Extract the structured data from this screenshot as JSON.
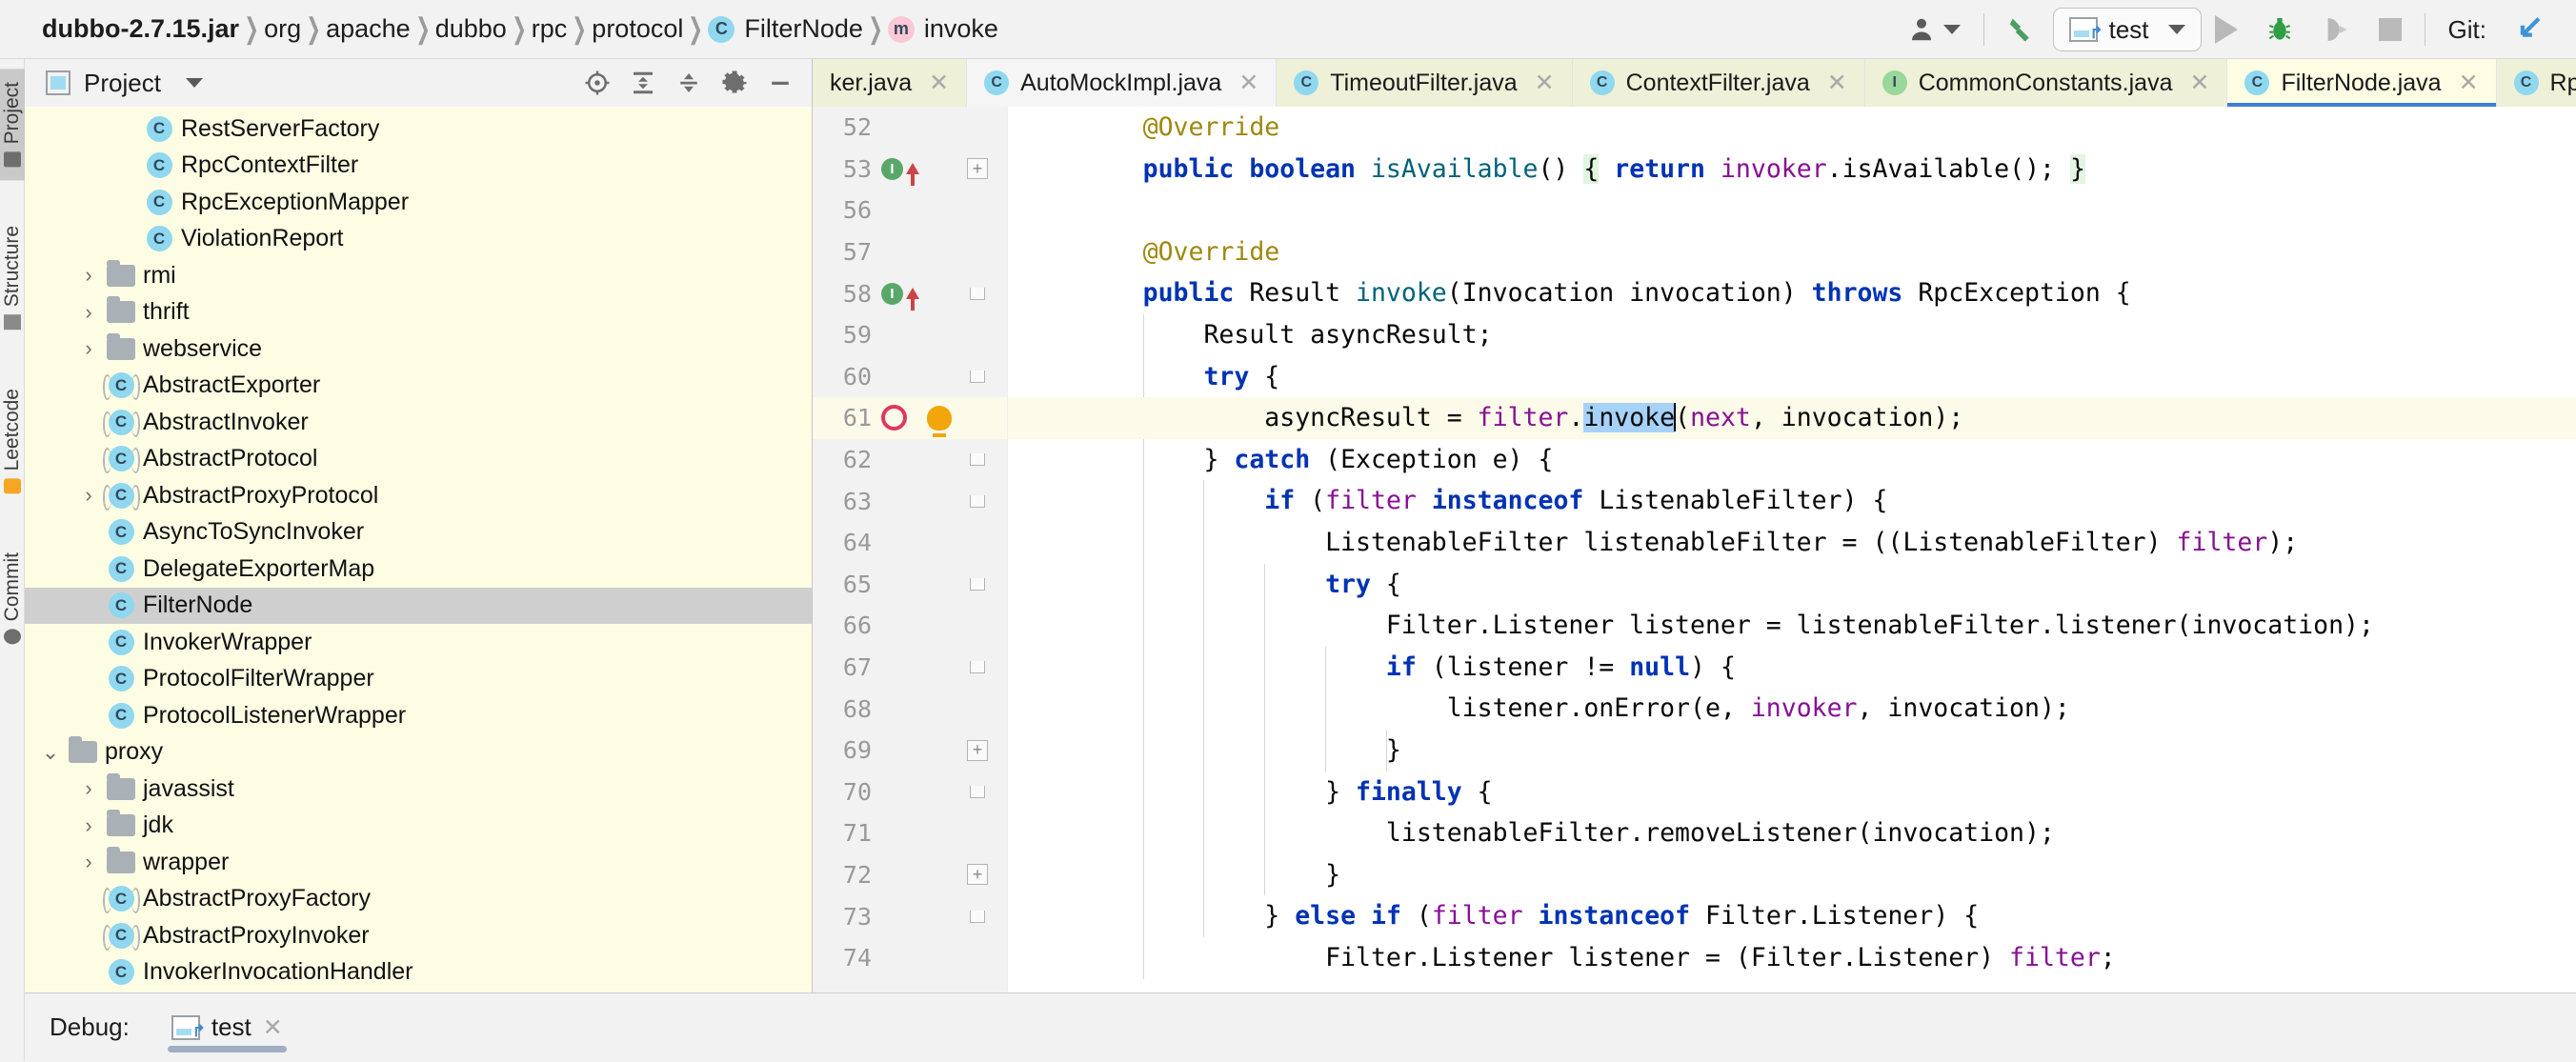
{
  "breadcrumb": {
    "items": [
      {
        "label": "dubbo-2.7.15.jar",
        "bold": true,
        "icon": null
      },
      {
        "label": "org",
        "bold": false,
        "icon": null
      },
      {
        "label": "apache",
        "bold": false,
        "icon": null
      },
      {
        "label": "dubbo",
        "bold": false,
        "icon": null
      },
      {
        "label": "rpc",
        "bold": false,
        "icon": null
      },
      {
        "label": "protocol",
        "bold": false,
        "icon": null
      },
      {
        "label": "FilterNode",
        "bold": false,
        "icon": "class-icon"
      },
      {
        "label": "invoke",
        "bold": false,
        "icon": "method-icon"
      }
    ]
  },
  "toolbar": {
    "user_icon": "user-icon",
    "build_icon": "build-hammer-icon",
    "run_config": "test",
    "run_icon": "run-icon",
    "debug_icon": "debug-bug-icon",
    "coverage_icon": "run-with-coverage-icon",
    "stop_icon": "stop-icon",
    "git_label": "Git:",
    "git_icon": "git-update-icon"
  },
  "rail": {
    "items": [
      {
        "label": "Project",
        "icon": "project-folder-icon",
        "active": true
      },
      {
        "label": "Structure",
        "icon": "structure-icon",
        "active": false
      },
      {
        "label": "Leetcode",
        "icon": "leetcode-icon",
        "active": false
      },
      {
        "label": "Commit",
        "icon": "commit-icon",
        "active": false
      }
    ]
  },
  "project_panel": {
    "title": "Project",
    "title_icon": "project-window-icon",
    "dropdown_icon": "chevron-down-icon",
    "tools": [
      {
        "name": "locate-icon"
      },
      {
        "name": "expand-all-icon"
      },
      {
        "name": "collapse-all-icon"
      },
      {
        "name": "settings-gear-icon"
      },
      {
        "name": "hide-minimize-icon"
      }
    ],
    "tree": [
      {
        "label": "RestServerFactory",
        "kind": "class",
        "indent": 3,
        "arrow": "none",
        "selected": false
      },
      {
        "label": "RpcContextFilter",
        "kind": "class",
        "indent": 3,
        "arrow": "none",
        "selected": false
      },
      {
        "label": "RpcExceptionMapper",
        "kind": "class",
        "indent": 3,
        "arrow": "none",
        "selected": false
      },
      {
        "label": "ViolationReport",
        "kind": "class",
        "indent": 3,
        "arrow": "none",
        "selected": false
      },
      {
        "label": "rmi",
        "kind": "folder",
        "indent": 2,
        "arrow": "collapsed",
        "selected": false
      },
      {
        "label": "thrift",
        "kind": "folder",
        "indent": 2,
        "arrow": "collapsed",
        "selected": false
      },
      {
        "label": "webservice",
        "kind": "folder",
        "indent": 2,
        "arrow": "collapsed",
        "selected": false
      },
      {
        "label": "AbstractExporter",
        "kind": "abstract-class",
        "indent": 2,
        "arrow": "none",
        "selected": false
      },
      {
        "label": "AbstractInvoker",
        "kind": "abstract-class",
        "indent": 2,
        "arrow": "none",
        "selected": false
      },
      {
        "label": "AbstractProtocol",
        "kind": "abstract-class",
        "indent": 2,
        "arrow": "none",
        "selected": false
      },
      {
        "label": "AbstractProxyProtocol",
        "kind": "abstract-class",
        "indent": 2,
        "arrow": "collapsed",
        "selected": false
      },
      {
        "label": "AsyncToSyncInvoker",
        "kind": "class",
        "indent": 2,
        "arrow": "none",
        "selected": false
      },
      {
        "label": "DelegateExporterMap",
        "kind": "class",
        "indent": 2,
        "arrow": "none",
        "selected": false
      },
      {
        "label": "FilterNode",
        "kind": "class",
        "indent": 2,
        "arrow": "none",
        "selected": true
      },
      {
        "label": "InvokerWrapper",
        "kind": "class",
        "indent": 2,
        "arrow": "none",
        "selected": false
      },
      {
        "label": "ProtocolFilterWrapper",
        "kind": "class",
        "indent": 2,
        "arrow": "none",
        "selected": false
      },
      {
        "label": "ProtocolListenerWrapper",
        "kind": "class",
        "indent": 2,
        "arrow": "none",
        "selected": false
      },
      {
        "label": "proxy",
        "kind": "folder",
        "indent": 1,
        "arrow": "expanded",
        "selected": false
      },
      {
        "label": "javassist",
        "kind": "folder",
        "indent": 2,
        "arrow": "collapsed",
        "selected": false
      },
      {
        "label": "jdk",
        "kind": "folder",
        "indent": 2,
        "arrow": "collapsed",
        "selected": false
      },
      {
        "label": "wrapper",
        "kind": "folder",
        "indent": 2,
        "arrow": "collapsed",
        "selected": false
      },
      {
        "label": "AbstractProxyFactory",
        "kind": "abstract-class",
        "indent": 2,
        "arrow": "none",
        "selected": false
      },
      {
        "label": "AbstractProxyInvoker",
        "kind": "abstract-class",
        "indent": 2,
        "arrow": "none",
        "selected": false
      },
      {
        "label": "InvokerInvocationHandler",
        "kind": "class",
        "indent": 2,
        "arrow": "none",
        "selected": false
      }
    ]
  },
  "editor": {
    "tabs": [
      {
        "label": "ker.java",
        "icon": null,
        "active": false,
        "modified": false,
        "truncated": true
      },
      {
        "label": "AutoMockImpl.java",
        "icon": "class-icon",
        "active": false,
        "modified": true
      },
      {
        "label": "TimeoutFilter.java",
        "icon": "class-icon",
        "active": false,
        "modified": false
      },
      {
        "label": "ContextFilter.java",
        "icon": "class-icon",
        "active": false,
        "modified": false
      },
      {
        "label": "CommonConstants.java",
        "icon": "interface-icon",
        "active": false,
        "modified": false
      },
      {
        "label": "FilterNode.java",
        "icon": "class-icon",
        "active": true,
        "modified": false
      },
      {
        "label": "RpcContextFilter.",
        "icon": "class-icon",
        "active": false,
        "modified": false,
        "truncated": true
      }
    ],
    "close_icon": "close-icon",
    "lines": [
      {
        "num": "52",
        "indent": 2,
        "gutter": [],
        "fold": null,
        "tokens": [
          {
            "t": "@Override",
            "c": "anno"
          }
        ]
      },
      {
        "num": "53",
        "indent": 2,
        "gutter": [
          "implementing-method-icon",
          "override-arrow-icon"
        ],
        "fold": "start",
        "tokens": [
          {
            "t": "public ",
            "c": "kw"
          },
          {
            "t": "boolean ",
            "c": "kw"
          },
          {
            "t": "isAvailable",
            "c": "mth"
          },
          {
            "t": "() ",
            "c": "pln"
          },
          {
            "t": "{",
            "c": "hl"
          },
          {
            "t": " ",
            "c": "pln"
          },
          {
            "t": "return ",
            "c": "kw"
          },
          {
            "t": "invoker",
            "c": "fld"
          },
          {
            "t": ".isAvailable(); ",
            "c": "pln"
          },
          {
            "t": "}",
            "c": "hl"
          }
        ]
      },
      {
        "num": "56",
        "indent": 0,
        "gutter": [],
        "fold": null,
        "tokens": []
      },
      {
        "num": "57",
        "indent": 2,
        "gutter": [],
        "fold": null,
        "tokens": [
          {
            "t": "@Override",
            "c": "anno"
          }
        ]
      },
      {
        "num": "58",
        "indent": 2,
        "gutter": [
          "implementing-method-icon",
          "override-arrow-icon"
        ],
        "fold": "end",
        "tokens": [
          {
            "t": "public ",
            "c": "kw"
          },
          {
            "t": "Result ",
            "c": "pln"
          },
          {
            "t": "invoke",
            "c": "mth"
          },
          {
            "t": "(Invocation invocation) ",
            "c": "pln"
          },
          {
            "t": "throws ",
            "c": "kw"
          },
          {
            "t": "RpcException {",
            "c": "pln"
          }
        ]
      },
      {
        "num": "59",
        "indent": 3,
        "gutter": [],
        "fold": null,
        "tokens": [
          {
            "t": "Result asyncResult;",
            "c": "pln"
          }
        ]
      },
      {
        "num": "60",
        "indent": 3,
        "gutter": [],
        "fold": "end",
        "tokens": [
          {
            "t": "try ",
            "c": "kw"
          },
          {
            "t": "{",
            "c": "pln"
          }
        ]
      },
      {
        "num": "61",
        "indent": 4,
        "gutter": [
          "breakpoint-icon",
          "intention-bulb-icon"
        ],
        "fold": null,
        "highlighted": true,
        "tokens": [
          {
            "t": "asyncResult = ",
            "c": "pln"
          },
          {
            "t": "filter",
            "c": "fld"
          },
          {
            "t": ".",
            "c": "pln"
          },
          {
            "t": "invoke",
            "c": "sel"
          },
          {
            "t": "|",
            "c": "caret"
          },
          {
            "t": "(",
            "c": "pln"
          },
          {
            "t": "next",
            "c": "fld"
          },
          {
            "t": ", invocation);",
            "c": "pln"
          }
        ]
      },
      {
        "num": "62",
        "indent": 3,
        "gutter": [],
        "fold": "end",
        "tokens": [
          {
            "t": "} ",
            "c": "pln"
          },
          {
            "t": "catch ",
            "c": "kw"
          },
          {
            "t": "(Exception e) {",
            "c": "pln"
          }
        ]
      },
      {
        "num": "63",
        "indent": 4,
        "gutter": [],
        "fold": "end",
        "tokens": [
          {
            "t": "if ",
            "c": "kw"
          },
          {
            "t": "(",
            "c": "pln"
          },
          {
            "t": "filter ",
            "c": "fld"
          },
          {
            "t": "instanceof ",
            "c": "kw"
          },
          {
            "t": "ListenableFilter) {",
            "c": "pln"
          }
        ]
      },
      {
        "num": "64",
        "indent": 5,
        "gutter": [],
        "fold": null,
        "tokens": [
          {
            "t": "ListenableFilter listenableFilter = ((ListenableFilter) ",
            "c": "pln"
          },
          {
            "t": "filter",
            "c": "fld"
          },
          {
            "t": ");",
            "c": "pln"
          }
        ]
      },
      {
        "num": "65",
        "indent": 5,
        "gutter": [],
        "fold": "end",
        "tokens": [
          {
            "t": "try ",
            "c": "kw"
          },
          {
            "t": "{",
            "c": "pln"
          }
        ]
      },
      {
        "num": "66",
        "indent": 6,
        "gutter": [],
        "fold": null,
        "tokens": [
          {
            "t": "Filter.Listener listener = listenableFilter.listener(invocation);",
            "c": "pln"
          }
        ]
      },
      {
        "num": "67",
        "indent": 6,
        "gutter": [],
        "fold": "end",
        "tokens": [
          {
            "t": "if ",
            "c": "kw"
          },
          {
            "t": "(listener != ",
            "c": "pln"
          },
          {
            "t": "null",
            "c": "kw"
          },
          {
            "t": ") {",
            "c": "pln"
          }
        ]
      },
      {
        "num": "68",
        "indent": 7,
        "gutter": [],
        "fold": null,
        "tokens": [
          {
            "t": "listener.onError(e, ",
            "c": "pln"
          },
          {
            "t": "invoker",
            "c": "fld"
          },
          {
            "t": ", invocation);",
            "c": "pln"
          }
        ]
      },
      {
        "num": "69",
        "indent": 6,
        "gutter": [],
        "fold": "start",
        "tokens": [
          {
            "t": "}",
            "c": "pln"
          }
        ]
      },
      {
        "num": "70",
        "indent": 5,
        "gutter": [],
        "fold": "end",
        "tokens": [
          {
            "t": "} ",
            "c": "pln"
          },
          {
            "t": "finally ",
            "c": "kw"
          },
          {
            "t": "{",
            "c": "pln"
          }
        ]
      },
      {
        "num": "71",
        "indent": 6,
        "gutter": [],
        "fold": null,
        "tokens": [
          {
            "t": "listenableFilter.removeListener(invocation);",
            "c": "pln"
          }
        ]
      },
      {
        "num": "72",
        "indent": 5,
        "gutter": [],
        "fold": "start",
        "tokens": [
          {
            "t": "}",
            "c": "pln"
          }
        ]
      },
      {
        "num": "73",
        "indent": 4,
        "gutter": [],
        "fold": "end",
        "tokens": [
          {
            "t": "} ",
            "c": "pln"
          },
          {
            "t": "else ",
            "c": "kw"
          },
          {
            "t": "if ",
            "c": "kw"
          },
          {
            "t": "(",
            "c": "pln"
          },
          {
            "t": "filter ",
            "c": "fld"
          },
          {
            "t": "instanceof ",
            "c": "kw"
          },
          {
            "t": "Filter.Listener) {",
            "c": "pln"
          }
        ]
      },
      {
        "num": "74",
        "indent": 5,
        "gutter": [],
        "fold": null,
        "tokens": [
          {
            "t": "Filter.Listener listener = (Filter.Listener) ",
            "c": "pln"
          },
          {
            "t": "filter",
            "c": "fld"
          },
          {
            "t": ";",
            "c": "pln"
          }
        ]
      }
    ]
  },
  "bottom": {
    "debug_label": "Debug:",
    "tab_label": "test",
    "tab_icon": "run-config-icon",
    "close_icon": "close-icon"
  }
}
